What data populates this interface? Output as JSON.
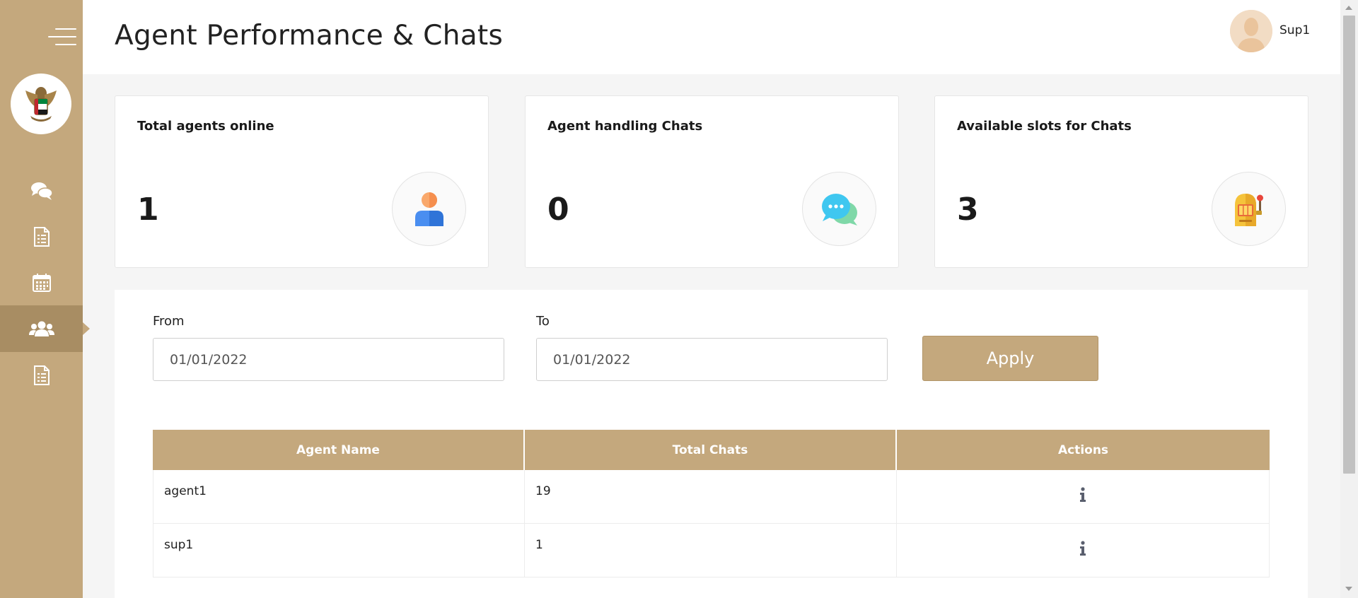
{
  "header": {
    "title": "Agent Performance & Chats",
    "user_name": "Sup1"
  },
  "sidebar": {
    "items": [
      {
        "name": "chats",
        "icon": "chat-bubbles-icon"
      },
      {
        "name": "reports",
        "icon": "document-list-icon"
      },
      {
        "name": "calendar",
        "icon": "calendar-icon"
      },
      {
        "name": "agents",
        "icon": "users-icon",
        "active": true
      },
      {
        "name": "logs",
        "icon": "document-list-icon"
      }
    ]
  },
  "cards": [
    {
      "title": "Total agents online",
      "value": "1",
      "icon": "agent-icon"
    },
    {
      "title": "Agent handling Chats",
      "value": "0",
      "icon": "chat-icon"
    },
    {
      "title": "Available slots for Chats",
      "value": "3",
      "icon": "slot-machine-icon"
    }
  ],
  "filters": {
    "from_label": "From",
    "from_value": "01/01/2022",
    "to_label": "To",
    "to_value": "01/01/2022",
    "apply_label": "Apply"
  },
  "table": {
    "columns": [
      "Agent Name",
      "Total Chats",
      "Actions"
    ],
    "rows": [
      {
        "agent": "agent1",
        "chats": "19"
      },
      {
        "agent": "sup1",
        "chats": "1"
      }
    ]
  },
  "colors": {
    "accent": "#c4a87d",
    "accent_dark": "#a88d63"
  }
}
